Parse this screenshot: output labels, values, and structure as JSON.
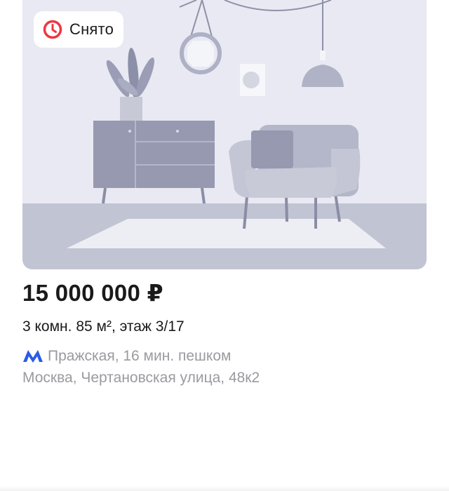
{
  "listing": {
    "status_label": "Снято",
    "price": "15 000 000 ₽",
    "details": "3 комн. 85 м², этаж 3/17",
    "metro_station": "Пражская, 16 мин. пешком",
    "address": "Москва, Чертановская улица, 48к2"
  },
  "icons": {
    "status": "clock-icon",
    "metro": "metro-icon"
  },
  "colors": {
    "status_icon": "#f0353f",
    "metro_icon": "#2b5ce6",
    "secondary_text": "#9a9aa0",
    "primary_text": "#1a1a1a"
  }
}
